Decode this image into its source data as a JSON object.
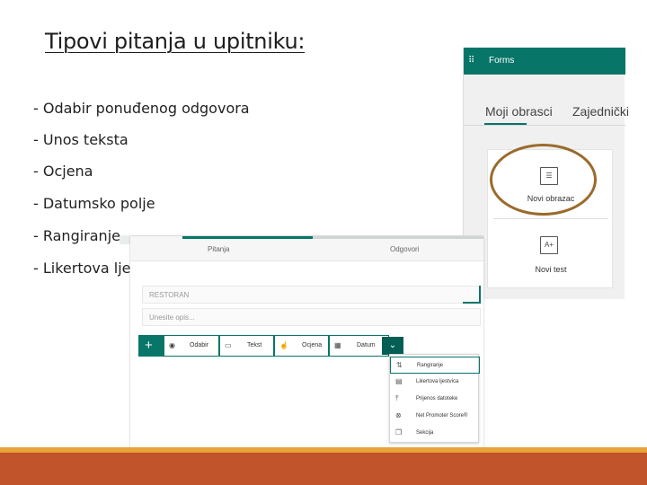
{
  "slide": {
    "title": "Tipovi pitanja u upitniku:",
    "bullets": [
      "- Odabir ponuđenog odgovora",
      "- Unos teksta",
      "- Ocjena",
      "- Datumsko polje",
      "- Rangiranje",
      "- Likertova ljestvica"
    ]
  },
  "forms_panel": {
    "app_name": "Forms",
    "tabs": [
      "Moji obrasci",
      "Zajednički"
    ],
    "new_form_label": "Novi obrazac",
    "new_quiz_label": "Novi test"
  },
  "editor": {
    "tabs": [
      "Pitanja",
      "Odgovori"
    ],
    "form_title": "RESTORAN",
    "description_placeholder": "Unesite opis...",
    "question_types": [
      "Odabir",
      "Tekst",
      "Ocjena",
      "Datum"
    ],
    "dropdown_items": [
      {
        "label": "Rangiranje",
        "icon": "ranking-icon"
      },
      {
        "label": "Likertova ljestvica",
        "icon": "likert-icon"
      },
      {
        "label": "Prijenos datoteke",
        "icon": "upload-icon"
      },
      {
        "label": "Net Promoter Score®",
        "icon": "nps-icon"
      },
      {
        "label": "Sekcija",
        "icon": "section-icon"
      }
    ]
  },
  "colors": {
    "forms_teal": "#077568",
    "footer": "#c1542a",
    "accent_line": "#e8a33a",
    "highlight_ring": "#9a6a2c"
  }
}
